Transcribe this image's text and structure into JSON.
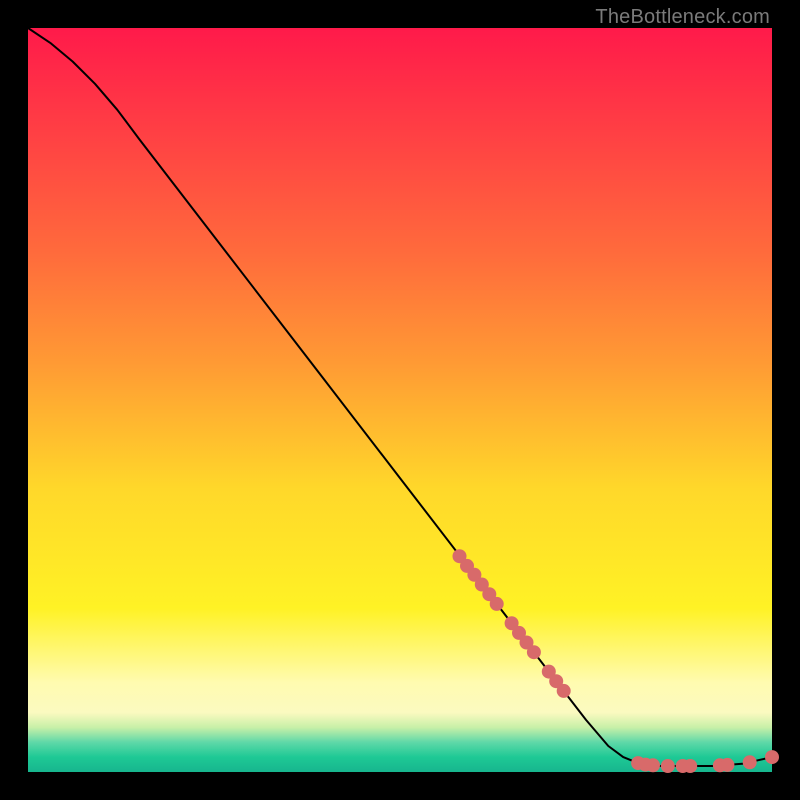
{
  "watermark": "TheBottleneck.com",
  "colors": {
    "background": "#000000",
    "gradient_top": "#ff1a4a",
    "gradient_bottom": "#17b58e",
    "line": "#000000",
    "marker": "#d86a6a"
  },
  "chart_data": {
    "type": "line",
    "title": "",
    "xlabel": "",
    "ylabel": "",
    "xlim": [
      0,
      100
    ],
    "ylim": [
      0,
      100
    ],
    "grid": false,
    "legend": false,
    "series": [
      {
        "name": "curve",
        "x": [
          0,
          3,
          6,
          9,
          12,
          15,
          20,
          30,
          40,
          50,
          60,
          65,
          70,
          75,
          78,
          80,
          82,
          85,
          88,
          92,
          96,
          100
        ],
        "y": [
          100,
          98,
          95.5,
          92.5,
          89,
          85,
          78.5,
          65.5,
          52.5,
          39.5,
          26.5,
          20,
          13.5,
          7,
          3.5,
          2,
          1.2,
          0.8,
          0.8,
          0.8,
          1.1,
          2
        ]
      }
    ],
    "markers": [
      {
        "x": 58,
        "y": 29
      },
      {
        "x": 59,
        "y": 27.7
      },
      {
        "x": 60,
        "y": 26.5
      },
      {
        "x": 61,
        "y": 25.2
      },
      {
        "x": 62,
        "y": 23.9
      },
      {
        "x": 63,
        "y": 22.6
      },
      {
        "x": 65,
        "y": 20
      },
      {
        "x": 66,
        "y": 18.7
      },
      {
        "x": 67,
        "y": 17.4
      },
      {
        "x": 68,
        "y": 16.1
      },
      {
        "x": 70,
        "y": 13.5
      },
      {
        "x": 71,
        "y": 12.2
      },
      {
        "x": 72,
        "y": 10.9
      },
      {
        "x": 82,
        "y": 1.2
      },
      {
        "x": 83,
        "y": 1.0
      },
      {
        "x": 84,
        "y": 0.9
      },
      {
        "x": 86,
        "y": 0.8
      },
      {
        "x": 88,
        "y": 0.8
      },
      {
        "x": 89,
        "y": 0.8
      },
      {
        "x": 93,
        "y": 0.9
      },
      {
        "x": 94,
        "y": 0.95
      },
      {
        "x": 97,
        "y": 1.3
      },
      {
        "x": 100,
        "y": 2
      }
    ]
  }
}
